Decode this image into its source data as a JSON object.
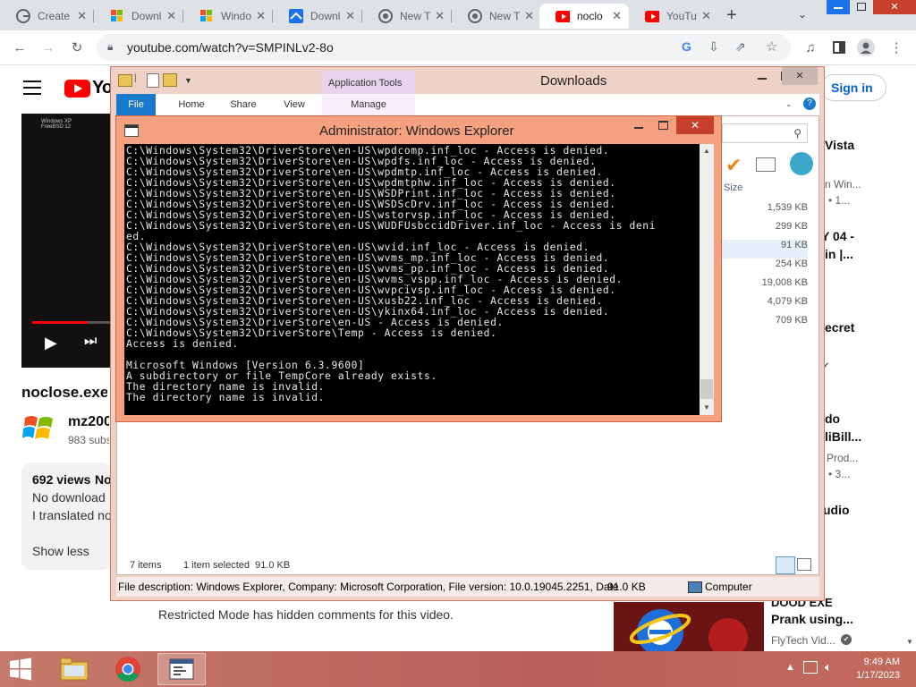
{
  "browser": {
    "tabs": [
      {
        "title": "Create",
        "icon": "google-icon"
      },
      {
        "title": "Downl",
        "icon": "windows-icon"
      },
      {
        "title": "Windo",
        "icon": "windows-icon"
      },
      {
        "title": "Downl",
        "icon": "site-icon"
      },
      {
        "title": "New T",
        "icon": "chrome-icon"
      },
      {
        "title": "New T",
        "icon": "chrome-icon"
      },
      {
        "title": "noclo",
        "icon": "youtube-icon"
      },
      {
        "title": "YouTu",
        "icon": "youtube-icon"
      }
    ],
    "url": "youtube.com/watch?v=SMPINLv2-8o"
  },
  "youtube": {
    "logo": "YouTube",
    "sign_in": "Sign in",
    "video_title": "noclose.exe",
    "channel_name": "mz200",
    "subscribers": "983 subs",
    "views": "692 views",
    "desc_fragment": "No",
    "desc_line1": "No download",
    "desc_line2": "I translated no",
    "show_less": "Show less",
    "restricted": "Restricted Mode has hidden comments for this video.",
    "thumb_text_1": "Windows XP",
    "thumb_text_2": "FreeBSD 12",
    "sidebar": {
      "vista": "Vista",
      "n_win": "n Win...",
      "dot1": "• 1...",
      "y04": "Y 04 -",
      "in": "in |...",
      "ecret": "ecret",
      "do": "do",
      "libill": "liBill...",
      "prod": "Prod...",
      "dot3": "• 3...",
      "udio": "udio",
      "card_title1": "DOOD EXE",
      "card_title2": "Prank using...",
      "card_channel": "FlyTech Vid..."
    }
  },
  "explorer": {
    "title": "Downloads",
    "app_tools": "Application Tools",
    "tabs": [
      "File",
      "Home",
      "Share",
      "View",
      "Manage"
    ],
    "size_header": "Size",
    "sizes": [
      "1,539 KB",
      "299 KB",
      "91 KB",
      "254 KB",
      "19,008 KB",
      "4,079 KB",
      "709 KB"
    ],
    "items_count": "7 items",
    "selected": "1 item selected  91.0 KB",
    "status_desc": "File description: Windows Explorer, Company: Microsoft Corporation, File version: 10.0.19045.2251, Date",
    "status_size": "91.0 KB",
    "status_location": "Computer"
  },
  "cmd": {
    "title": "Administrator:  Windows Explorer",
    "output": "C:\\Windows\\System32\\DriverStore\\en-US\\wpdcomp.inf_loc - Access is denied.\nC:\\Windows\\System32\\DriverStore\\en-US\\wpdfs.inf_loc - Access is denied.\nC:\\Windows\\System32\\DriverStore\\en-US\\wpdmtp.inf_loc - Access is denied.\nC:\\Windows\\System32\\DriverStore\\en-US\\wpdmtphw.inf_loc - Access is denied.\nC:\\Windows\\System32\\DriverStore\\en-US\\WSDPrint.inf_loc - Access is denied.\nC:\\Windows\\System32\\DriverStore\\en-US\\WSDScDrv.inf_loc - Access is denied.\nC:\\Windows\\System32\\DriverStore\\en-US\\wstorvsp.inf_loc - Access is denied.\nC:\\Windows\\System32\\DriverStore\\en-US\\WUDFUsbccidDriver.inf_loc - Access is deni\ned.\nC:\\Windows\\System32\\DriverStore\\en-US\\wvid.inf_loc - Access is denied.\nC:\\Windows\\System32\\DriverStore\\en-US\\wvms_mp.inf_loc - Access is denied.\nC:\\Windows\\System32\\DriverStore\\en-US\\wvms_pp.inf_loc - Access is denied.\nC:\\Windows\\System32\\DriverStore\\en-US\\wvms_vspp.inf_loc - Access is denied.\nC:\\Windows\\System32\\DriverStore\\en-US\\wvpcivsp.inf_loc - Access is denied.\nC:\\Windows\\System32\\DriverStore\\en-US\\xusb22.inf_loc - Access is denied.\nC:\\Windows\\System32\\DriverStore\\en-US\\ykinx64.inf_loc - Access is denied.\nC:\\Windows\\System32\\DriverStore\\en-US - Access is denied.\nC:\\Windows\\System32\\DriverStore\\Temp - Access is denied.\nAccess is denied.\n\nMicrosoft Windows [Version 6.3.9600]\nA subdirectory or file TempCore already exists.\nThe directory name is invalid.\nThe directory name is invalid."
  },
  "taskbar": {
    "time": "9:49 AM",
    "date": "1/17/2023"
  },
  "colors": {
    "youtube_red": "#ff0000",
    "explorer_frame": "#eed2c8",
    "cmd_frame": "#f5a17f",
    "close_red": "#c7402b",
    "taskbar": "#b7605a"
  }
}
